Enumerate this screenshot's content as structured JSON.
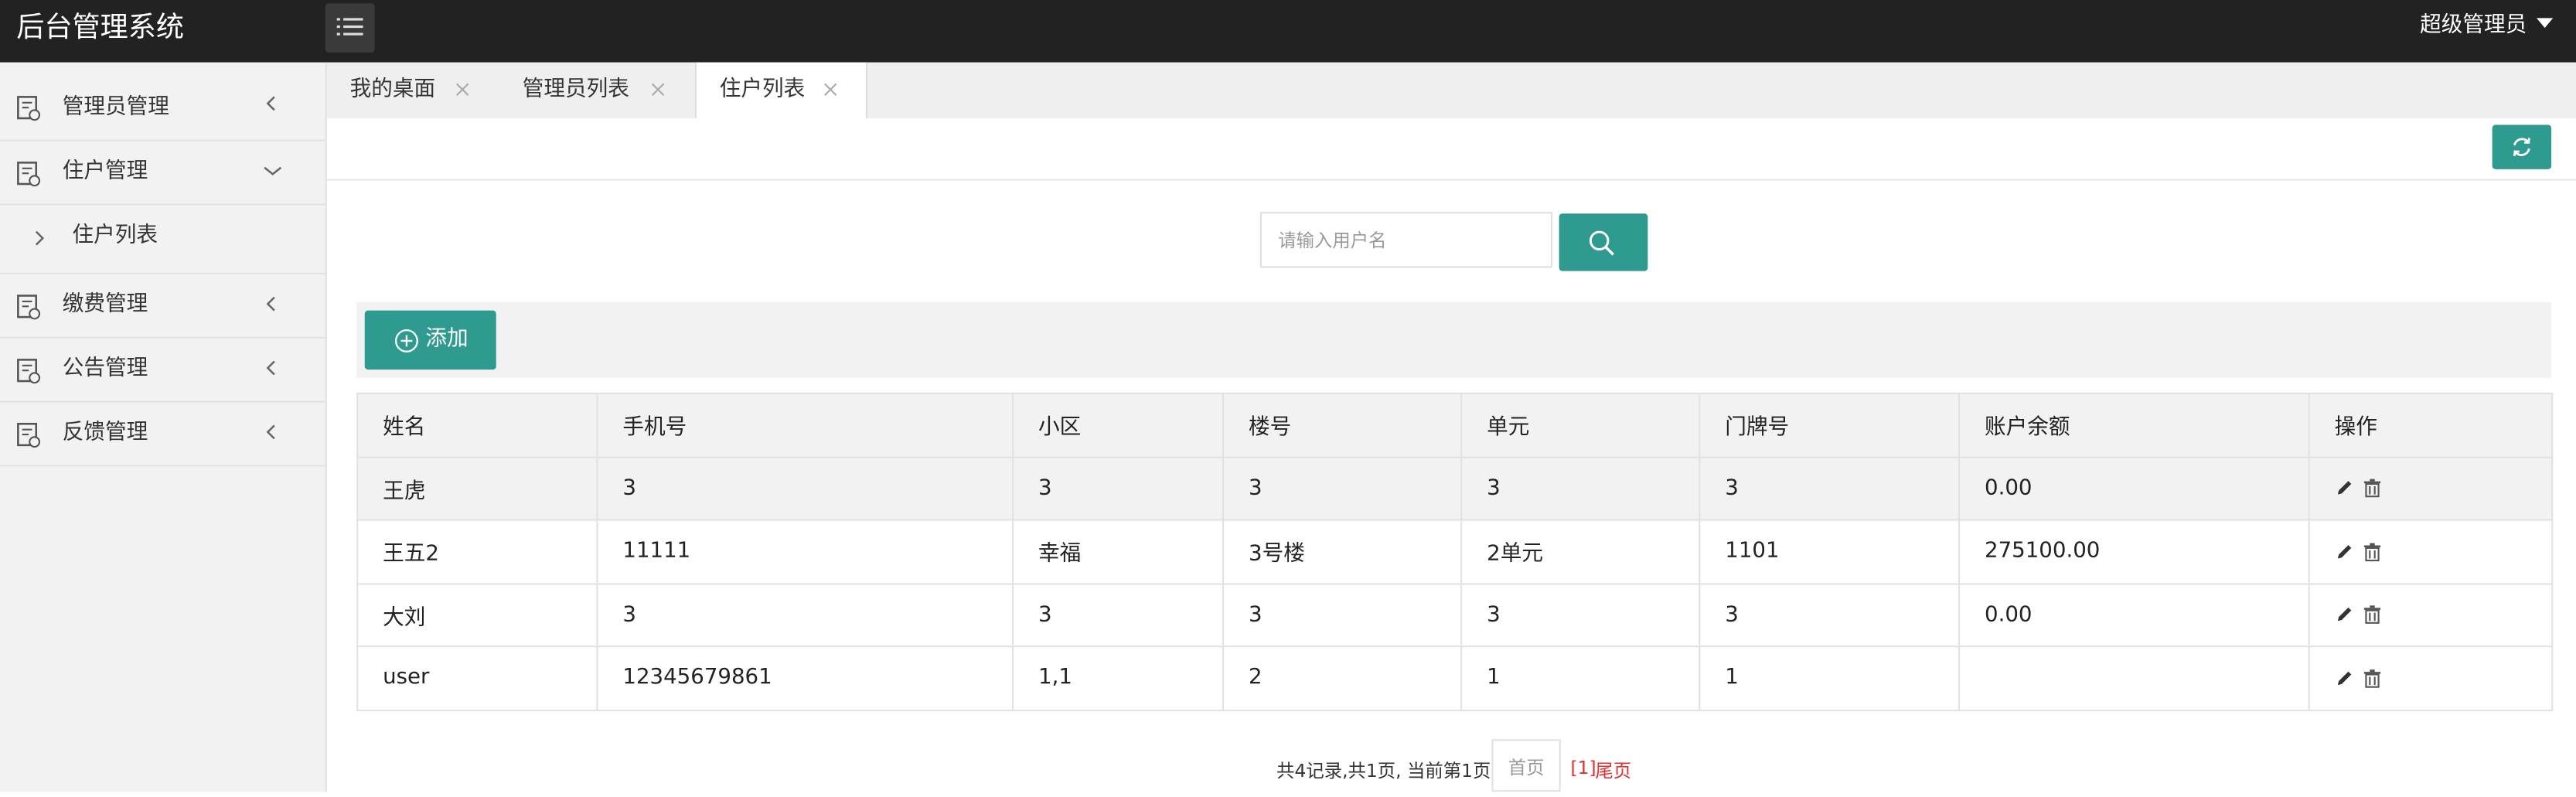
{
  "app": {
    "title": "后台管理系统"
  },
  "header": {
    "user": "超级管理员"
  },
  "sidebar": {
    "items": [
      {
        "label": "管理员管理"
      },
      {
        "label": "住户管理"
      },
      {
        "label": "住户列表"
      },
      {
        "label": "缴费管理"
      },
      {
        "label": "公告管理"
      },
      {
        "label": "反馈管理"
      }
    ]
  },
  "tabs": [
    {
      "label": "我的桌面"
    },
    {
      "label": "管理员列表"
    },
    {
      "label": "住户列表"
    }
  ],
  "search": {
    "placeholder": "请输入用户名"
  },
  "toolbar": {
    "add_label": "添加"
  },
  "table": {
    "headers": [
      "姓名",
      "手机号",
      "小区",
      "楼号",
      "单元",
      "门牌号",
      "账户余额",
      "操作"
    ],
    "rows": [
      [
        "王虎",
        "3",
        "3",
        "3",
        "3",
        "3",
        "0.00"
      ],
      [
        "王五2",
        "11111",
        "幸福",
        "3号楼",
        "2单元",
        "1101",
        "275100.00"
      ],
      [
        "大刘",
        "3",
        "3",
        "3",
        "3",
        "3",
        "0.00"
      ],
      [
        "user",
        "12345679861",
        "1,1",
        "2",
        "1",
        "1",
        ""
      ]
    ]
  },
  "pagination": {
    "info": "共4记录,共1页, 当前第1页",
    "first_label": "首页",
    "current": "[1]",
    "last_label": "尾页"
  },
  "colors": {
    "topbar": "#222222",
    "accent": "#2f9a8f",
    "sidebar": "#f2f2f2",
    "pager_active": "#e03131"
  },
  "icons": [
    "menu-list-icon",
    "document-icon",
    "chevron-left-icon",
    "chevron-down-icon",
    "chevron-right-icon",
    "close-icon",
    "refresh-icon",
    "search-icon",
    "plus-circle-icon",
    "edit-icon",
    "trash-icon"
  ]
}
